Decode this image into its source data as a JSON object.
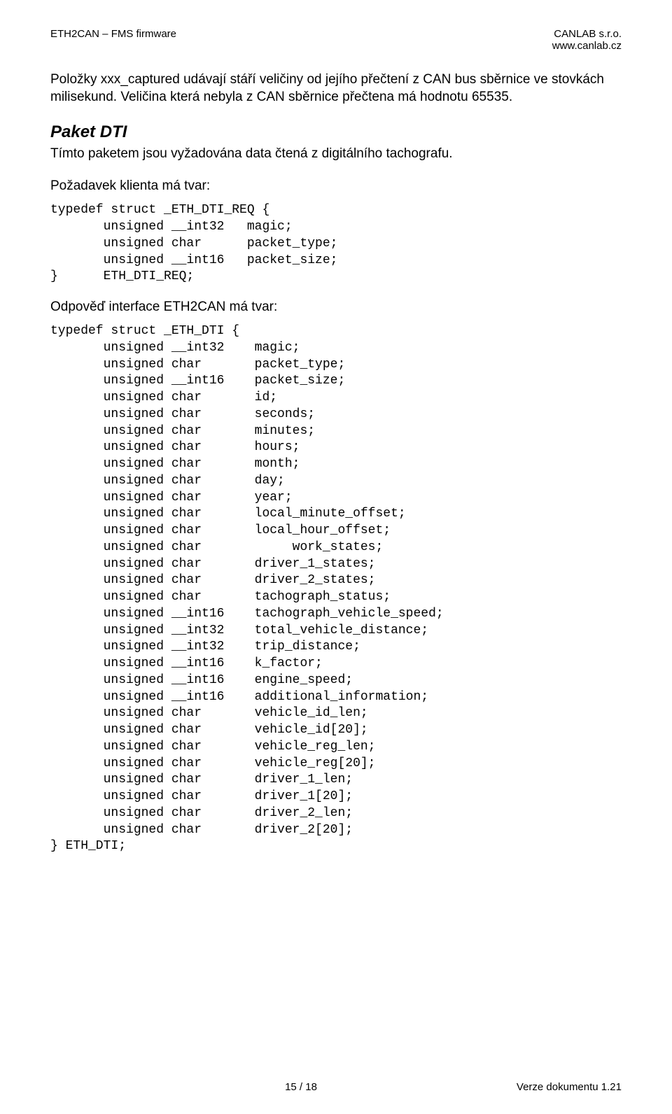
{
  "header": {
    "left": "ETH2CAN – FMS firmware",
    "right_top": "CANLAB s.r.o.",
    "right_bottom": "www.canlab.cz"
  },
  "para1": "Položky xxx_captured udávají stáří veličiny od jejího přečtení z CAN bus sběrnice ve stovkách milisekund. Veličina která nebyla z CAN sběrnice přečtena má hodnotu 65535.",
  "heading_dti": "Paket DTI",
  "sub_dti": "Tímto paketem jsou vyžadována data čtená z digitálního tachografu.",
  "req_label": "Požadavek klienta má tvar:",
  "code_req": "typedef struct _ETH_DTI_REQ {\n       unsigned __int32   magic;\n       unsigned char      packet_type;\n       unsigned __int16   packet_size;\n}      ETH_DTI_REQ;",
  "resp_label": "Odpověď interface ETH2CAN má tvar:",
  "code_resp": "typedef struct _ETH_DTI {\n       unsigned __int32    magic;\n       unsigned char       packet_type;\n       unsigned __int16    packet_size;\n       unsigned char       id;\n       unsigned char       seconds;\n       unsigned char       minutes;\n       unsigned char       hours;\n       unsigned char       month;\n       unsigned char       day;\n       unsigned char       year;\n       unsigned char       local_minute_offset;\n       unsigned char       local_hour_offset;\n       unsigned char            work_states;\n       unsigned char       driver_1_states;\n       unsigned char       driver_2_states;\n       unsigned char       tachograph_status;\n       unsigned __int16    tachograph_vehicle_speed;\n       unsigned __int32    total_vehicle_distance;\n       unsigned __int32    trip_distance;\n       unsigned __int16    k_factor;\n       unsigned __int16    engine_speed;\n       unsigned __int16    additional_information;\n       unsigned char       vehicle_id_len;\n       unsigned char       vehicle_id[20];\n       unsigned char       vehicle_reg_len;\n       unsigned char       vehicle_reg[20];\n       unsigned char       driver_1_len;\n       unsigned char       driver_1[20];\n       unsigned char       driver_2_len;\n       unsigned char       driver_2[20];\n} ETH_DTI;",
  "footer": {
    "left": "",
    "center": "15 / 18",
    "right": "Verze dokumentu 1.21"
  }
}
